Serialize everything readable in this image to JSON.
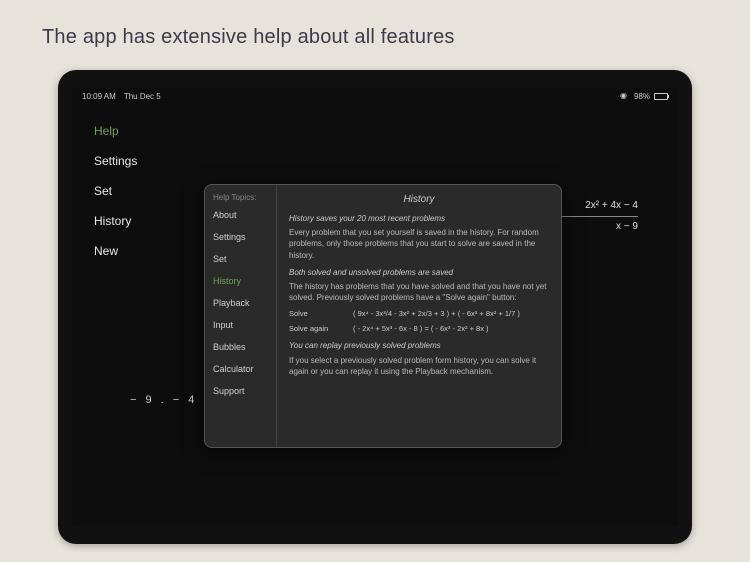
{
  "caption": "The app has extensive help about all features",
  "status": {
    "time": "10:09 AM",
    "date": "Thu Dec 5",
    "battery_pct": "98%"
  },
  "menu": {
    "items": [
      {
        "label": "Help",
        "active": true
      },
      {
        "label": "Settings",
        "active": false
      },
      {
        "label": "Set",
        "active": false
      },
      {
        "label": "History",
        "active": false
      },
      {
        "label": "New",
        "active": false
      }
    ]
  },
  "equations": {
    "top_line": "2x² + 4x − 4",
    "bottom_line": "x − 9",
    "residual": "− 9 . − 4"
  },
  "popover": {
    "topics_label": "Help Topics:",
    "topics": [
      {
        "label": "About",
        "active": false
      },
      {
        "label": "Settings",
        "active": false
      },
      {
        "label": "Set",
        "active": false
      },
      {
        "label": "History",
        "active": true
      },
      {
        "label": "Playback",
        "active": false
      },
      {
        "label": "Input",
        "active": false
      },
      {
        "label": "Bubbles",
        "active": false
      },
      {
        "label": "Calculator",
        "active": false
      },
      {
        "label": "Support",
        "active": false
      }
    ],
    "content": {
      "title": "History",
      "h1": "History saves your 20 most recent problems",
      "p1": "Every problem that you set yourself is saved in the history. For random problems, only those problems that you start to solve are saved in the history.",
      "h2": "Both solved and unsolved problems are saved",
      "p2": "The history has problems that you have solved and that you have not yet solved. Previously solved problems have a \"Solve again\" button:",
      "ex1_label": "Solve",
      "ex1_expr": "( 9x⁴ - 3x³/4 - 3x² + 2x/3 + 3 ) + ( - 6x³ + 8x² + 1/7 )",
      "ex2_label": "Solve again",
      "ex2_expr": "( - 2x⁴ + 5x³ - 6x - 8 ) = ( - 6x³ - 2x² + 8x )",
      "h3": "You can replay previously solved problems",
      "p3": "If you select a previously solved problem form history, you can solve it again or you can replay it using the Playback mechanism."
    }
  }
}
